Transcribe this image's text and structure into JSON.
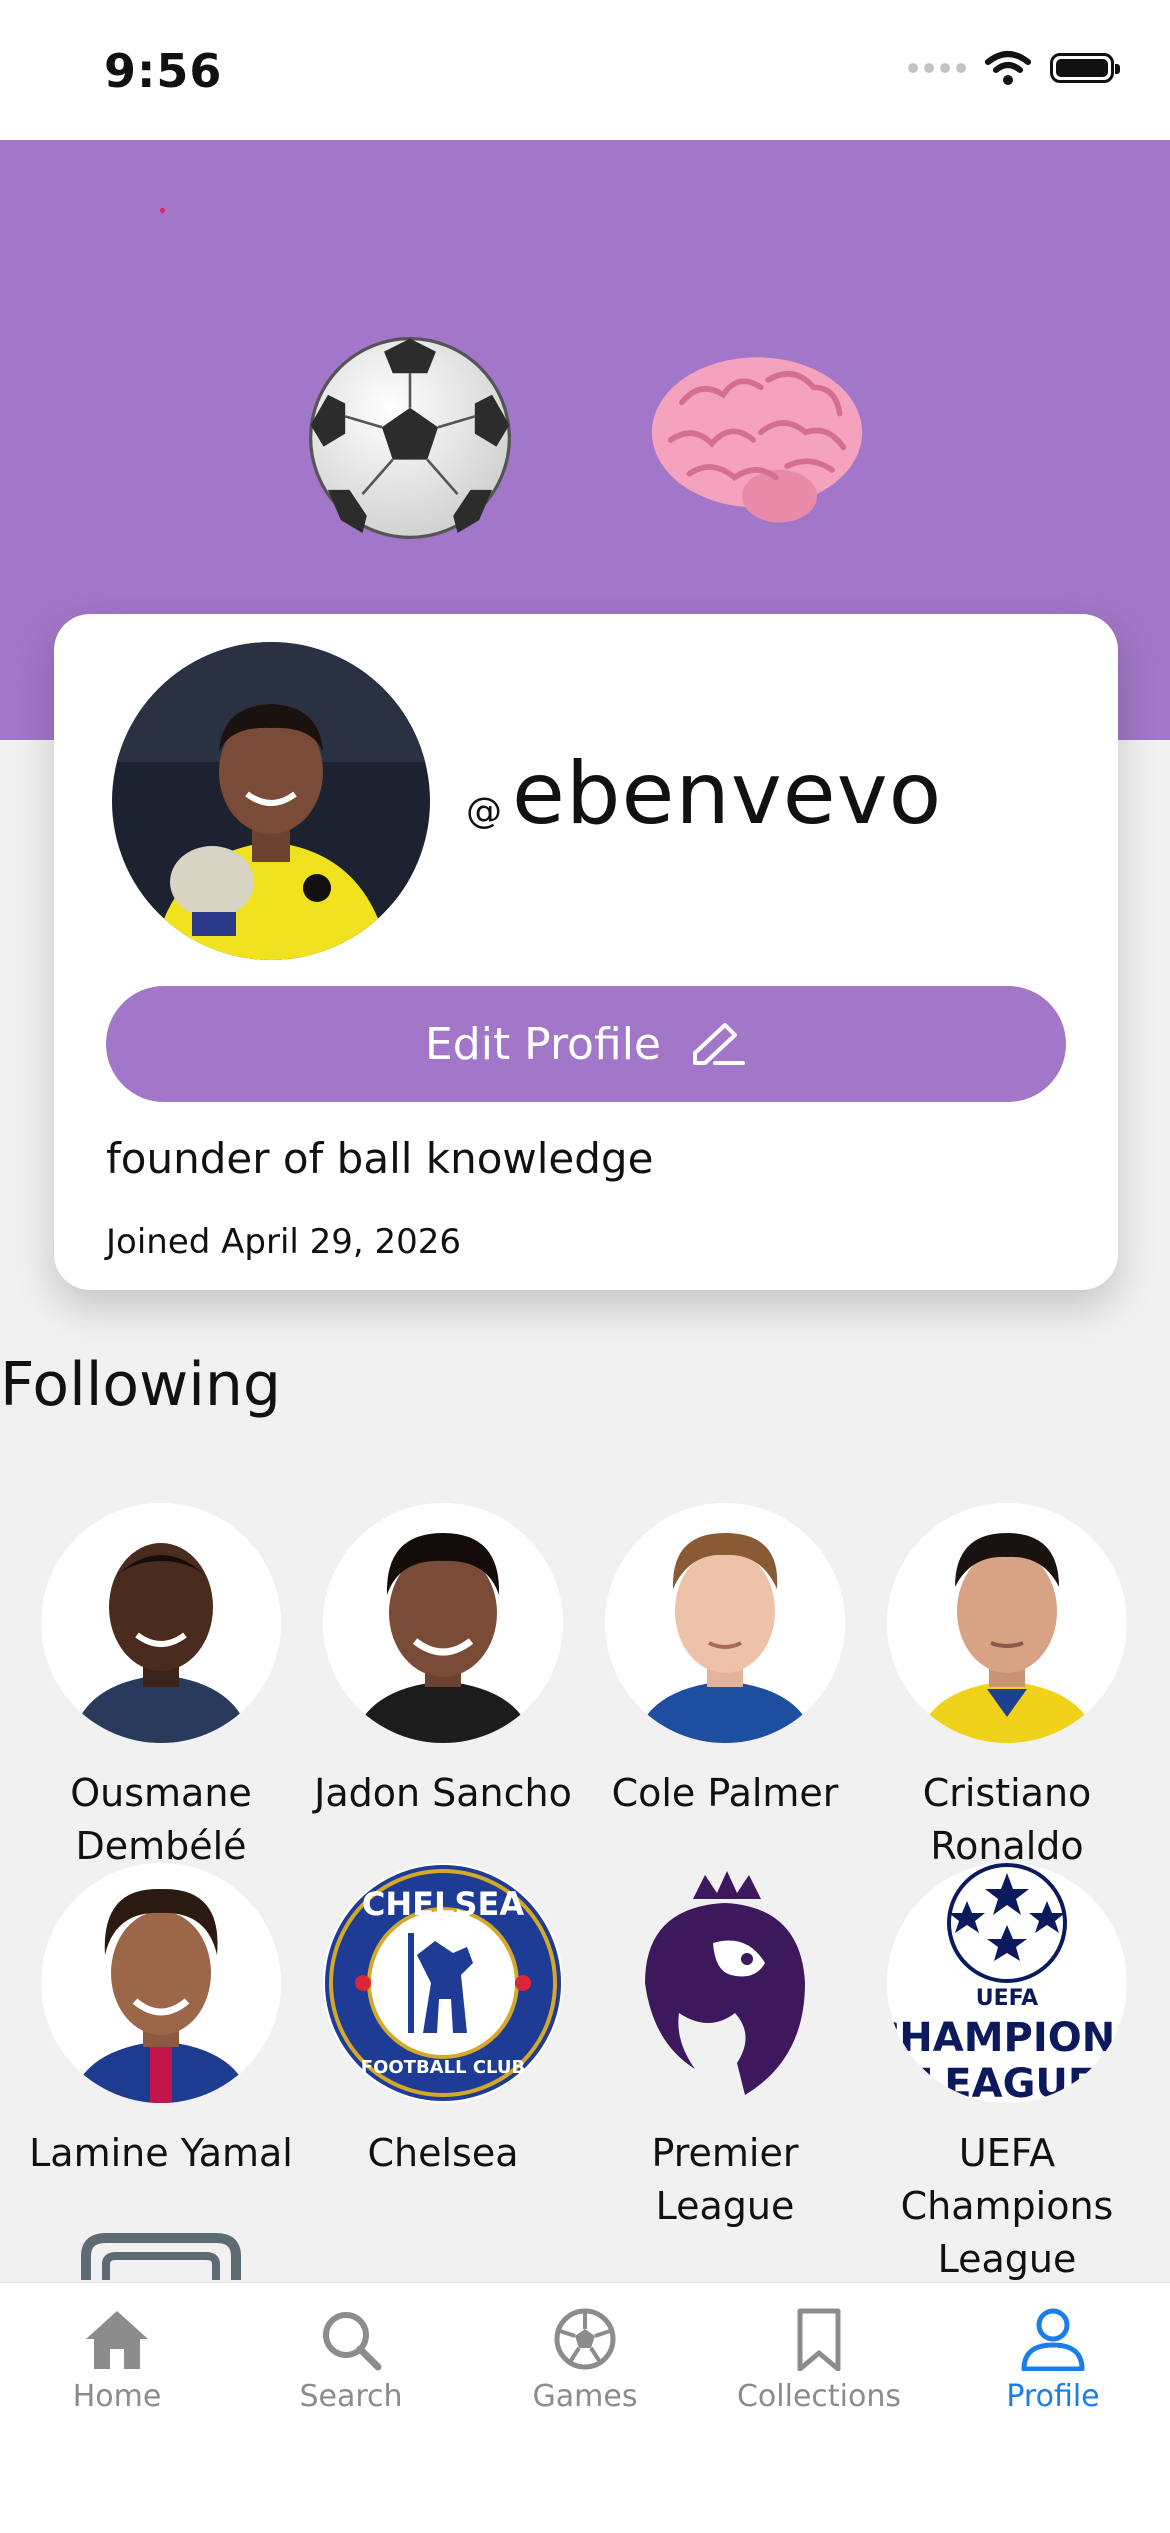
{
  "status_bar": {
    "time": "9:56"
  },
  "banner": {
    "emoji": [
      "⚽",
      "🧠"
    ]
  },
  "profile": {
    "at_symbol": "@",
    "username": "ebenvevo",
    "edit_button": "Edit Profile",
    "bio": "founder of ball knowledge",
    "joined": "Joined April 29, 2026"
  },
  "following": {
    "title": "Following",
    "items": [
      {
        "name": "Ousmane Dembélé"
      },
      {
        "name": "Jadon Sancho"
      },
      {
        "name": "Cole Palmer"
      },
      {
        "name": "Cristiano Ronaldo"
      },
      {
        "name": "Lamine Yamal"
      },
      {
        "name": "Chelsea"
      },
      {
        "name": "Premier League"
      },
      {
        "name": "UEFA Champions League"
      }
    ]
  },
  "tabs": [
    {
      "label": "Home",
      "icon": "house-icon"
    },
    {
      "label": "Search",
      "icon": "magnifier-icon"
    },
    {
      "label": "Games",
      "icon": "soccer-ball-icon"
    },
    {
      "label": "Collections",
      "icon": "bookmark-icon"
    },
    {
      "label": "Profile",
      "icon": "person-icon",
      "active": true
    }
  ],
  "colors": {
    "accent": "#a276c8",
    "active_tab": "#1b7ee8",
    "inactive_tab": "#8c8c8c"
  }
}
